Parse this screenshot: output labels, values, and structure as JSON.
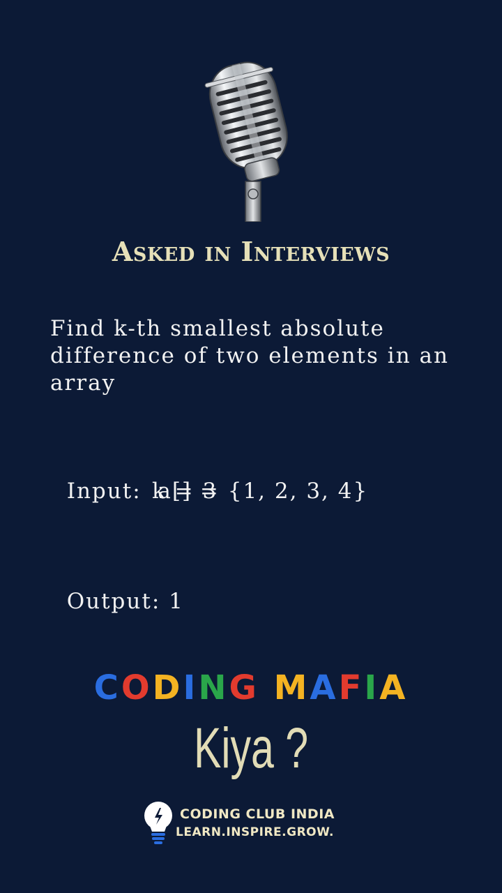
{
  "heading": "Asked in Interviews",
  "question": "Find k-th smallest absolute difference of two elements in an array",
  "input_label": "Input:",
  "input_array": "a[] = {1, 2, 3, 4}",
  "input_k": "k = 3",
  "output_label": "Output:",
  "output_value": "1",
  "brand": {
    "letters": [
      {
        "char": "C",
        "color": "#2a6de0"
      },
      {
        "char": "O",
        "color": "#e23b2e"
      },
      {
        "char": "D",
        "color": "#f4b322"
      },
      {
        "char": "I",
        "color": "#2a6de0"
      },
      {
        "char": "N",
        "color": "#2aa64a"
      },
      {
        "char": "G",
        "color": "#e23b2e"
      },
      {
        "char": " ",
        "color": "#ffffff"
      },
      {
        "char": "M",
        "color": "#f4b322"
      },
      {
        "char": "A",
        "color": "#2a6de0"
      },
      {
        "char": "F",
        "color": "#e23b2e"
      },
      {
        "char": "I",
        "color": "#2aa64a"
      },
      {
        "char": "A",
        "color": "#f4b322"
      }
    ]
  },
  "tagline": "Kiya ?",
  "club": {
    "name": "CODING CLUB INDIA",
    "motto": "LEARN.INSPIRE.GROW."
  },
  "icons": {
    "mic": "microphone-icon",
    "bulb": "lightbulb-icon"
  }
}
